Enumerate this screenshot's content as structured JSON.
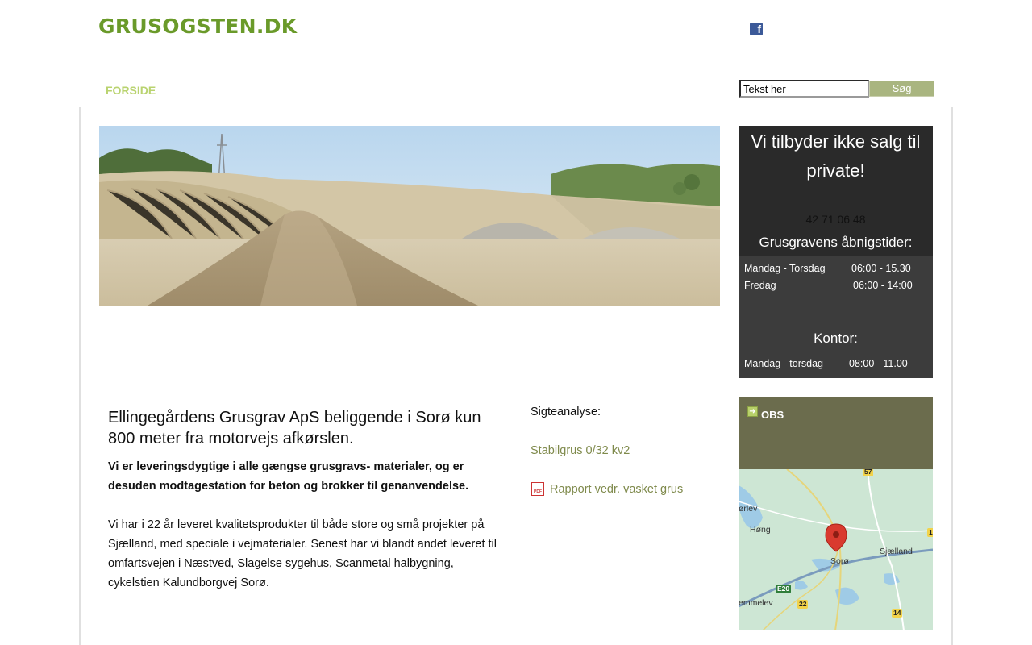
{
  "header": {
    "logo": "GRUSOGSTEN.DK",
    "nav_home": "FORSIDE",
    "search_placeholder": "Tekst her",
    "search_button": "Søg"
  },
  "sidebar": {
    "headline": "Vi tilbyder ikke salg til private!",
    "phone": "42 71  06 48",
    "opening_title": "Grusgravens åbnigstider:",
    "opening_rows": [
      {
        "day": "Mandag - Torsdag",
        "time": "06:00 - 15.30"
      },
      {
        "day": "Fredag",
        "time": "06:00 - 14:00"
      }
    ],
    "office_title": "Kontor:",
    "office_rows": [
      {
        "day": "Mandag - torsdag",
        "time": "08:00 - 11.00"
      }
    ],
    "obs_label": "OBS",
    "map": {
      "labels": [
        "ørlev",
        "Høng",
        "Sjælland",
        "Sorø",
        "emmelev"
      ],
      "road_shields": [
        "57",
        "1",
        "E20",
        "22",
        "14"
      ]
    }
  },
  "main": {
    "title": "Ellingegårdens Grusgrav ApS beliggende i Sorø kun 800 meter fra motorvejs afkørslen.",
    "bold_text": "Vi er leveringsdygtige i alle gængse grusgravs- materialer, og er desuden modtagestation for beton og brokker til genanvendelse.",
    "body_text": "Vi har i 22 år leveret kvalitetsprodukter til både store og små projekter på Sjælland, med speciale i vejmaterialer. Senest har vi blandt andet leveret til omfartsvejen i Næstved, Slagelse sygehus, Scanmetal halbygning, cykelstien Kalundborgvej Sorø."
  },
  "side_links": {
    "label": "Sigteanalyse:",
    "link1": "Stabilgrus 0/32 kv2",
    "link2": "Rapport vedr. vasket grus"
  },
  "colors": {
    "logo_green": "#6a9a2a",
    "nav_green": "#b9d36f",
    "link_olive": "#7f8a4c",
    "obs_olive": "#6b6c4d",
    "dark_panel": "#2e2e2e"
  }
}
